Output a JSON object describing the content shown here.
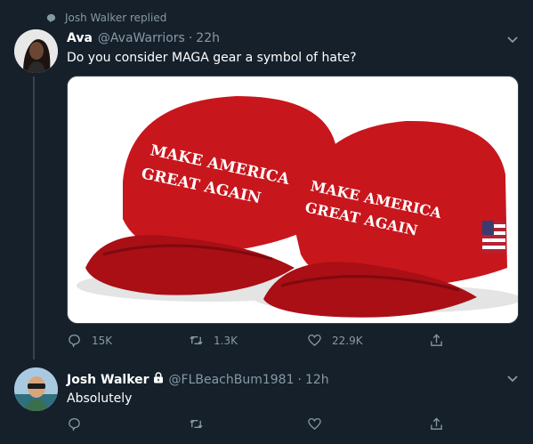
{
  "reply_context": {
    "text": "Josh Walker replied",
    "icon": "reply-bubble-icon"
  },
  "tweet1": {
    "name": "Ava",
    "handle": "@AvaWarriors",
    "separator": "·",
    "time": "22h",
    "text": "Do you consider MAGA gear a symbol of hate?",
    "media": {
      "left_cap_text": [
        "MAKE AMERICA",
        "GREAT AGAIN"
      ],
      "right_cap_text": [
        "MAKE AMERICA",
        "GREAT AGAIN"
      ]
    },
    "actions": {
      "reply_count": "15K",
      "retweet_count": "1.3K",
      "like_count": "22.9K"
    }
  },
  "tweet2": {
    "name": "Josh Walker",
    "handle": "@FLBeachBum1981",
    "separator": "·",
    "time": "12h",
    "text": "Absolutely",
    "verified_lock_icon": "lock-icon"
  },
  "colors": {
    "background": "#15202b",
    "secondary_text": "#8899a6",
    "divider": "#38444d",
    "cap_red": "#c8161d"
  }
}
